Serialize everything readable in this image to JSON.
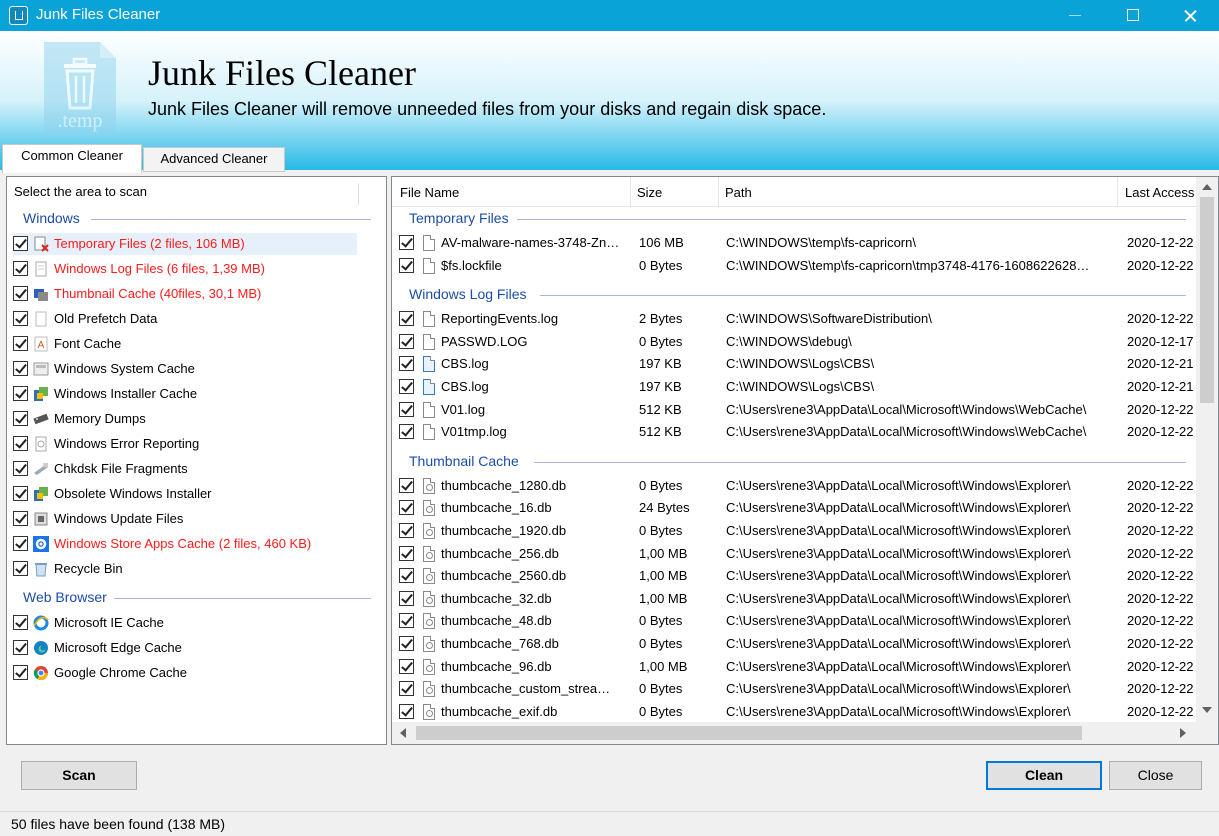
{
  "window": {
    "title": "Junk Files Cleaner"
  },
  "banner": {
    "title": "Junk Files Cleaner",
    "subtitle": "Junk Files Cleaner will remove unneeded files from your disks and regain disk space.",
    "logo_text": ".temp"
  },
  "tabs": [
    {
      "label": "Common Cleaner",
      "active": true
    },
    {
      "label": "Advanced Cleaner",
      "active": false
    }
  ],
  "left": {
    "header": "Select the area to scan",
    "groups": [
      {
        "label": "Windows",
        "items": [
          {
            "label": "Temporary Files (2 files, 106 MB)",
            "checked": true,
            "highlight": true,
            "icon": "temp-files-icon"
          },
          {
            "label": "Windows Log Files (6 files, 1,39 MB)",
            "checked": true,
            "highlight": true,
            "icon": "log-file-icon"
          },
          {
            "label": "Thumbnail Cache (40files, 30,1 MB)",
            "checked": true,
            "highlight": true,
            "icon": "thumbnail-icon"
          },
          {
            "label": "Old Prefetch Data",
            "checked": true,
            "highlight": false,
            "icon": "prefetch-icon"
          },
          {
            "label": "Font Cache",
            "checked": true,
            "highlight": false,
            "icon": "font-icon"
          },
          {
            "label": "Windows System Cache",
            "checked": true,
            "highlight": false,
            "icon": "system-cache-icon"
          },
          {
            "label": "Windows Installer Cache",
            "checked": true,
            "highlight": false,
            "icon": "installer-icon"
          },
          {
            "label": "Memory Dumps",
            "checked": true,
            "highlight": false,
            "icon": "memory-icon"
          },
          {
            "label": "Windows Error Reporting",
            "checked": true,
            "highlight": false,
            "icon": "error-report-icon"
          },
          {
            "label": "Chkdsk File Fragments",
            "checked": true,
            "highlight": false,
            "icon": "chkdsk-icon"
          },
          {
            "label": "Obsolete Windows Installer",
            "checked": true,
            "highlight": false,
            "icon": "installer-icon"
          },
          {
            "label": "Windows Update Files",
            "checked": true,
            "highlight": false,
            "icon": "update-icon"
          },
          {
            "label": "Windows Store Apps Cache (2 files, 460 KB)",
            "checked": true,
            "highlight": true,
            "icon": "gear-icon"
          },
          {
            "label": "Recycle Bin",
            "checked": true,
            "highlight": false,
            "icon": "recycle-bin-icon"
          }
        ]
      },
      {
        "label": "Web Browser",
        "items": [
          {
            "label": "Microsoft IE Cache",
            "checked": true,
            "highlight": false,
            "icon": "ie-icon"
          },
          {
            "label": "Microsoft Edge Cache",
            "checked": true,
            "highlight": false,
            "icon": "edge-icon"
          },
          {
            "label": "Google Chrome Cache",
            "checked": true,
            "highlight": false,
            "icon": "chrome-icon"
          }
        ]
      }
    ]
  },
  "files": {
    "columns": [
      "File Name",
      "Size",
      "Path",
      "Last Access"
    ],
    "groups": [
      {
        "label": "Temporary Files",
        "rows": [
          {
            "name": "AV-malware-names-3748-Zn…",
            "size": "106 MB",
            "path": "C:\\WINDOWS\\temp\\fs-capricorn\\",
            "access": "2020-12-22",
            "icon": "file"
          },
          {
            "name": "$fs.lockfile",
            "size": "0 Bytes",
            "path": "C:\\WINDOWS\\temp\\fs-capricorn\\tmp3748-4176-1608622628…",
            "access": "2020-12-22",
            "icon": "file"
          }
        ]
      },
      {
        "label": "Windows Log Files",
        "rows": [
          {
            "name": "ReportingEvents.log",
            "size": "2 Bytes",
            "path": "C:\\WINDOWS\\SoftwareDistribution\\",
            "access": "2020-12-22",
            "icon": "file"
          },
          {
            "name": "PASSWD.LOG",
            "size": "0 Bytes",
            "path": "C:\\WINDOWS\\debug\\",
            "access": "2020-12-17",
            "icon": "file"
          },
          {
            "name": "CBS.log",
            "size": "197 KB",
            "path": "C:\\WINDOWS\\Logs\\CBS\\",
            "access": "2020-12-21",
            "icon": "cbs"
          },
          {
            "name": "CBS.log",
            "size": "197 KB",
            "path": "C:\\WINDOWS\\Logs\\CBS\\",
            "access": "2020-12-21",
            "icon": "cbs"
          },
          {
            "name": "V01.log",
            "size": "512 KB",
            "path": "C:\\Users\\rene3\\AppData\\Local\\Microsoft\\Windows\\WebCache\\",
            "access": "2020-12-22",
            "icon": "file"
          },
          {
            "name": "V01tmp.log",
            "size": "512 KB",
            "path": "C:\\Users\\rene3\\AppData\\Local\\Microsoft\\Windows\\WebCache\\",
            "access": "2020-12-22",
            "icon": "file"
          }
        ]
      },
      {
        "label": "Thumbnail Cache",
        "rows": [
          {
            "name": "thumbcache_1280.db",
            "size": "0 Bytes",
            "path": "C:\\Users\\rene3\\AppData\\Local\\Microsoft\\Windows\\Explorer\\",
            "access": "2020-12-22",
            "icon": "thumb"
          },
          {
            "name": "thumbcache_16.db",
            "size": "24 Bytes",
            "path": "C:\\Users\\rene3\\AppData\\Local\\Microsoft\\Windows\\Explorer\\",
            "access": "2020-12-22",
            "icon": "thumb"
          },
          {
            "name": "thumbcache_1920.db",
            "size": "0 Bytes",
            "path": "C:\\Users\\rene3\\AppData\\Local\\Microsoft\\Windows\\Explorer\\",
            "access": "2020-12-22",
            "icon": "thumb"
          },
          {
            "name": "thumbcache_256.db",
            "size": "1,00 MB",
            "path": "C:\\Users\\rene3\\AppData\\Local\\Microsoft\\Windows\\Explorer\\",
            "access": "2020-12-22",
            "icon": "thumb"
          },
          {
            "name": "thumbcache_2560.db",
            "size": "1,00 MB",
            "path": "C:\\Users\\rene3\\AppData\\Local\\Microsoft\\Windows\\Explorer\\",
            "access": "2020-12-22",
            "icon": "thumb"
          },
          {
            "name": "thumbcache_32.db",
            "size": "1,00 MB",
            "path": "C:\\Users\\rene3\\AppData\\Local\\Microsoft\\Windows\\Explorer\\",
            "access": "2020-12-22",
            "icon": "thumb"
          },
          {
            "name": "thumbcache_48.db",
            "size": "0 Bytes",
            "path": "C:\\Users\\rene3\\AppData\\Local\\Microsoft\\Windows\\Explorer\\",
            "access": "2020-12-22",
            "icon": "thumb"
          },
          {
            "name": "thumbcache_768.db",
            "size": "0 Bytes",
            "path": "C:\\Users\\rene3\\AppData\\Local\\Microsoft\\Windows\\Explorer\\",
            "access": "2020-12-22",
            "icon": "thumb"
          },
          {
            "name": "thumbcache_96.db",
            "size": "1,00 MB",
            "path": "C:\\Users\\rene3\\AppData\\Local\\Microsoft\\Windows\\Explorer\\",
            "access": "2020-12-22",
            "icon": "thumb"
          },
          {
            "name": "thumbcache_custom_strea…",
            "size": "0 Bytes",
            "path": "C:\\Users\\rene3\\AppData\\Local\\Microsoft\\Windows\\Explorer\\",
            "access": "2020-12-22",
            "icon": "thumb"
          },
          {
            "name": "thumbcache_exif.db",
            "size": "0 Bytes",
            "path": "C:\\Users\\rene3\\AppData\\Local\\Microsoft\\Windows\\Explorer\\",
            "access": "2020-12-22",
            "icon": "thumb"
          }
        ]
      }
    ]
  },
  "buttons": {
    "scan": "Scan",
    "clean": "Clean",
    "close": "Close"
  },
  "status": "50  files have been found (138 MB)",
  "colors": {
    "titlebar": "#0aa3d8",
    "group_label": "#1c4da6",
    "warning": "#ff1a1a",
    "default_button_border": "#0078d7"
  }
}
